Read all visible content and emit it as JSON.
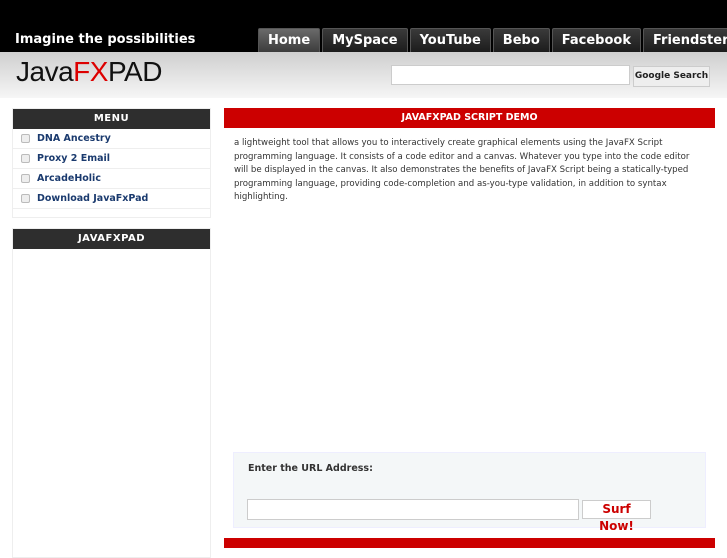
{
  "topbar": {
    "tagline": "Imagine the possibilities",
    "tabs": [
      "Home",
      "MySpace",
      "YouTube",
      "Bebo",
      "Facebook",
      "Friendster"
    ]
  },
  "header": {
    "logo_part1": "Java",
    "logo_part2": "FX",
    "logo_part3": "PAD",
    "search_value": "",
    "search_button": "Google Search"
  },
  "sidebar": {
    "menu_title": "MENU",
    "items": [
      "DNA Ancestry",
      "Proxy 2 Email",
      "ArcadeHolic",
      "Download JavaFxPad"
    ],
    "box2_title": "JAVAFXPAD"
  },
  "main": {
    "title": "JAVAFXPAD SCRIPT DEMO",
    "paragraph_lines": [
      "a lightweight tool that allows you to interactively create graphical elements using the JavaFX Script",
      "programming language. It consists of a code editor and a canvas. Whatever you type into the code editor",
      "will be displayed in the canvas. It also demonstrates the benefits of JavaFX Script being a statically-typed",
      "programming language, providing code-completion and as-you-type validation, in addition to syntax",
      "highlighting."
    ],
    "url_label": "Enter the URL Address:",
    "url_value": "",
    "surf_button": "Surf Now!"
  },
  "colors": {
    "accent": "#cc0000",
    "dark": "#2e2e2e"
  }
}
